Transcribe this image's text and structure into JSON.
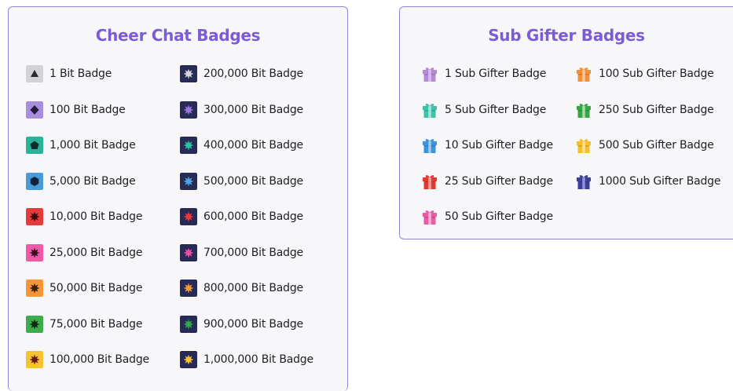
{
  "cheer": {
    "title": "Cheer Chat Badges",
    "items": [
      {
        "label": "1 Bit Badge",
        "bg": "#d2d2d8",
        "gem": "triangle",
        "gem_color": "#2a2a2a",
        "icon": "gray-triangle-bit-icon"
      },
      {
        "label": "100 Bit Badge",
        "bg": "#a98ee0",
        "gem": "diamond",
        "gem_color": "#231a3d",
        "icon": "purple-diamond-bit-icon"
      },
      {
        "label": "1,000 Bit Badge",
        "bg": "#2bb39a",
        "gem": "pentagon",
        "gem_color": "#0f2e2a",
        "icon": "teal-pentagon-bit-icon"
      },
      {
        "label": "5,000 Bit Badge",
        "bg": "#4a9ad8",
        "gem": "hexagon",
        "gem_color": "#0e223d",
        "icon": "blue-hexagon-bit-icon"
      },
      {
        "label": "10,000 Bit Badge",
        "bg": "#e33a3a",
        "gem": "star",
        "gem_color": "#3a0b0b",
        "icon": "red-star-bit-icon"
      },
      {
        "label": "25,000 Bit Badge",
        "bg": "#ee5aa6",
        "gem": "star",
        "gem_color": "#3b0d22",
        "icon": "pink-star-bit-icon"
      },
      {
        "label": "50,000 Bit Badge",
        "bg": "#f3963a",
        "gem": "star",
        "gem_color": "#3c1d07",
        "icon": "orange-star-bit-icon"
      },
      {
        "label": "75,000 Bit Badge",
        "bg": "#3cad4a",
        "gem": "star",
        "gem_color": "#0d2b10",
        "icon": "green-star-bit-icon"
      },
      {
        "label": "100,000 Bit Badge",
        "bg": "#f6c232",
        "gem": "star",
        "gem_color": "#6b1a1a",
        "icon": "yellow-star-bit-icon"
      },
      {
        "label": "200,000 Bit Badge",
        "bg": "#262a55",
        "gem": "star",
        "gem_color": "#d4d4dc",
        "icon": "silver-star-bit-icon"
      },
      {
        "label": "300,000 Bit Badge",
        "bg": "#262a55",
        "gem": "star",
        "gem_color": "#9b76dc",
        "icon": "violet-star-bit-icon"
      },
      {
        "label": "400,000 Bit Badge",
        "bg": "#262a55",
        "gem": "star",
        "gem_color": "#2ec0a2",
        "icon": "teal-star-bit-icon"
      },
      {
        "label": "500,000 Bit Badge",
        "bg": "#262a55",
        "gem": "star",
        "gem_color": "#4fa3e6",
        "icon": "blue-star-bit-icon"
      },
      {
        "label": "600,000 Bit Badge",
        "bg": "#262a55",
        "gem": "star",
        "gem_color": "#ea3535",
        "icon": "red-star-bit-icon"
      },
      {
        "label": "700,000 Bit Badge",
        "bg": "#262a55",
        "gem": "star",
        "gem_color": "#ec4ca2",
        "icon": "pink-star-bit-icon"
      },
      {
        "label": "800,000 Bit Badge",
        "bg": "#262a55",
        "gem": "star",
        "gem_color": "#f5963a",
        "icon": "orange-star-bit-icon"
      },
      {
        "label": "900,000 Bit Badge",
        "bg": "#262a55",
        "gem": "star",
        "gem_color": "#2da84c",
        "icon": "green-star-bit-icon"
      },
      {
        "label": "1,000,000 Bit Badge",
        "bg": "#262a55",
        "gem": "star",
        "gem_color": "#f6c232",
        "icon": "gold-star-bit-icon"
      }
    ]
  },
  "gifter": {
    "title": "Sub Gifter Badges",
    "items": [
      {
        "label": "1 Sub Gifter Badge",
        "box": "#b78ad8",
        "ribbon": "#d9bdf0",
        "icon": "purple-gift-icon"
      },
      {
        "label": "5 Sub Gifter Badge",
        "box": "#3fc2a8",
        "ribbon": "#9be8d8",
        "icon": "teal-gift-icon"
      },
      {
        "label": "10 Sub Gifter Badge",
        "box": "#3f93dc",
        "ribbon": "#9ccbf3",
        "icon": "blue-gift-icon"
      },
      {
        "label": "25 Sub Gifter Badge",
        "box": "#e23a33",
        "ribbon": "#f4a09b",
        "icon": "red-gift-icon"
      },
      {
        "label": "50 Sub Gifter Badge",
        "box": "#ea5aa6",
        "ribbon": "#f7b3d6",
        "icon": "pink-gift-icon"
      },
      {
        "label": "100 Sub Gifter Badge",
        "box": "#f0903a",
        "ribbon": "#f8c894",
        "icon": "orange-gift-icon"
      },
      {
        "label": "250 Sub Gifter Badge",
        "box": "#3aa544",
        "ribbon": "#9fdca4",
        "icon": "green-gift-icon"
      },
      {
        "label": "500 Sub Gifter Badge",
        "box": "#f4bf2a",
        "ribbon": "#fbe08e",
        "icon": "yellow-gift-icon"
      },
      {
        "label": "1000 Sub Gifter Badge",
        "box": "#3d3f9c",
        "ribbon": "#8e90d8",
        "icon": "indigo-gift-icon"
      }
    ]
  }
}
